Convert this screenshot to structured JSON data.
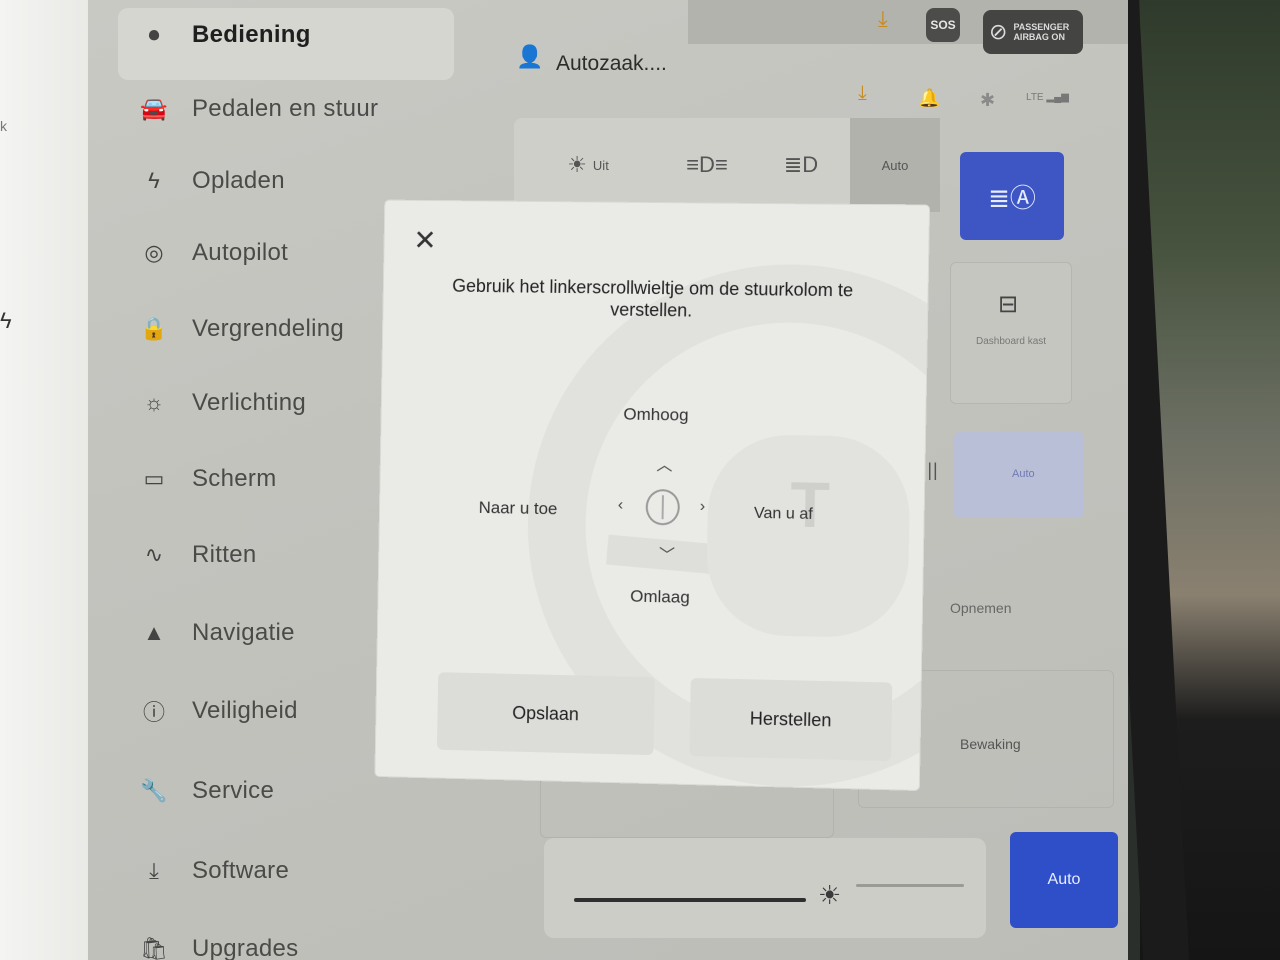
{
  "sidebar": {
    "items": [
      {
        "label": "Bediening",
        "icon": "toggle-icon",
        "active": true
      },
      {
        "label": "Pedalen en stuur",
        "icon": "car-icon"
      },
      {
        "label": "Opladen",
        "icon": "lightning-icon"
      },
      {
        "label": "Autopilot",
        "icon": "steering-wheel-icon"
      },
      {
        "label": "Vergrendeling",
        "icon": "lock-icon"
      },
      {
        "label": "Verlichting",
        "icon": "sun-icon"
      },
      {
        "label": "Scherm",
        "icon": "display-icon"
      },
      {
        "label": "Ritten",
        "icon": "trips-icon"
      },
      {
        "label": "Navigatie",
        "icon": "navigation-arrow-icon"
      },
      {
        "label": "Veiligheid",
        "icon": "alert-circle-icon"
      },
      {
        "label": "Service",
        "icon": "wrench-icon"
      },
      {
        "label": "Software",
        "icon": "download-icon"
      },
      {
        "label": "Upgrades",
        "icon": "bag-icon"
      }
    ]
  },
  "header": {
    "profile_name": "Autozaak....",
    "sos_label": "SOS",
    "airbag_line1": "PASSENGER",
    "airbag_line2": "AIRBAG ON",
    "lte_label": "LTE"
  },
  "lights": {
    "off_label": "Uit",
    "auto_label": "Auto"
  },
  "panel": {
    "dashboard_label": "Dashboard kast",
    "wiper_auto_label": "Auto",
    "record_label": "Opnemen",
    "sentry_label": "Bewaking",
    "brightness_auto_label": "Auto"
  },
  "modal": {
    "instruction": "Gebruik het linkerscrollwieltje om de stuurkolom te verstellen.",
    "up_label": "Omhoog",
    "down_label": "Omlaag",
    "toward_label": "Naar u toe",
    "away_label": "Van u af",
    "save_label": "Opslaan",
    "reset_label": "Herstellen"
  },
  "colors": {
    "accent_blue": "#3d56c4",
    "download_orange": "#c98a1e"
  }
}
